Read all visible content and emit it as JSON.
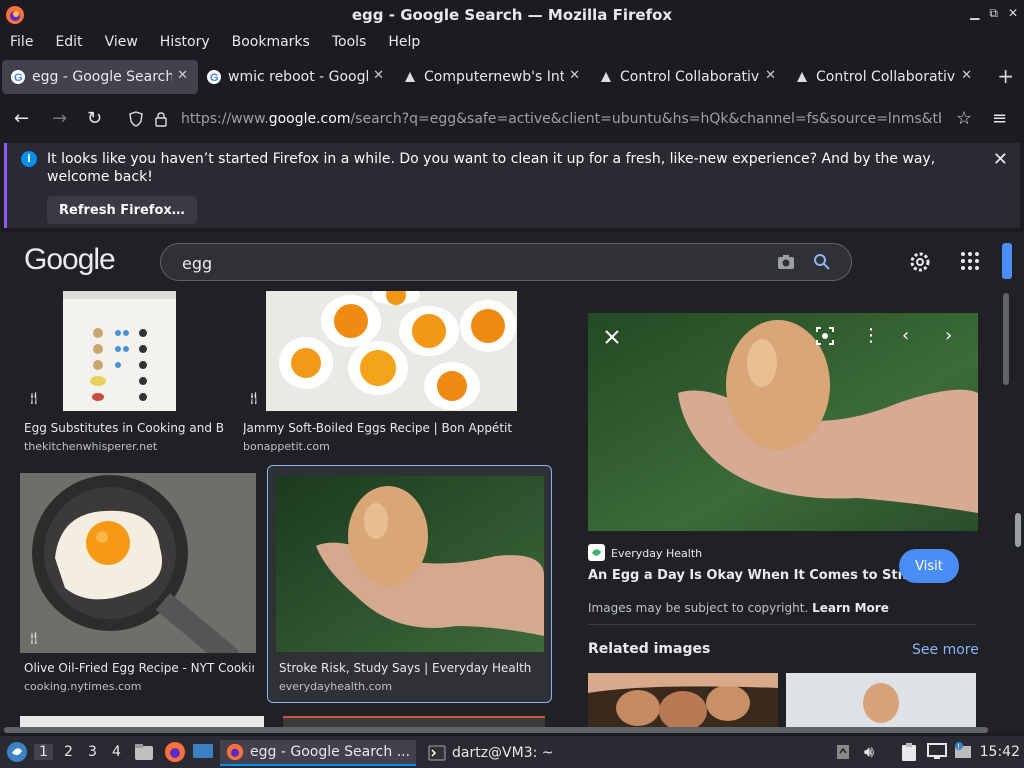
{
  "window": {
    "title": "egg - Google Search — Mozilla Firefox"
  },
  "menu": [
    "File",
    "Edit",
    "View",
    "History",
    "Bookmarks",
    "Tools",
    "Help"
  ],
  "tabs": [
    {
      "label": "egg - Google Search",
      "icon": "google-icon",
      "active": true
    },
    {
      "label": "wmic reboot - Google",
      "icon": "google-icon",
      "active": false
    },
    {
      "label": "Computernewb's Inte",
      "icon": "site-icon",
      "active": false
    },
    {
      "label": "Control Collaborative",
      "icon": "site-icon",
      "active": false
    },
    {
      "label": "Control Collaborative",
      "icon": "site-icon",
      "active": false
    }
  ],
  "url": {
    "scheme": "https://www.",
    "host": "google.com",
    "rest": "/search?q=egg&safe=active&client=ubuntu&hs=hQk&channel=fs&source=lnms&tb"
  },
  "notification": {
    "message": "It looks like you haven’t started Firefox in a while. Do you want to clean it up for a fresh, like-new experience? And by the way, welcome back!",
    "button": "Refresh Firefox…"
  },
  "google": {
    "logo": "Google",
    "query": "egg"
  },
  "results": [
    {
      "caption": "Egg Substitutes in Cooking and B...",
      "source": "thekitchenwhisperer.net"
    },
    {
      "caption": "Jammy Soft-Boiled Eggs Recipe | Bon Appétit",
      "source": "bonappetit.com"
    },
    {
      "caption": "Olive Oil-Fried Egg Recipe - NYT Cooking",
      "source": "cooking.nytimes.com"
    },
    {
      "caption": "Stroke Risk, Study Says | Everyday Health",
      "source": "everydayhealth.com"
    }
  ],
  "preview": {
    "site": "Everyday Health",
    "title": "An Egg a Day Is Okay When It Comes to Str...",
    "visit": "Visit",
    "copyright": "Images may be subject to copyright.",
    "learn_more": "Learn More",
    "related": "Related images",
    "see_more": "See more"
  },
  "taskbar": {
    "workspaces": [
      "1",
      "2",
      "3",
      "4"
    ],
    "firefox_task": "egg - Google Search ...",
    "terminal_task": "dartz@VM3: ~",
    "clock": "15:42"
  },
  "colors": {
    "accent": "#8ab4f8",
    "visit_button": "#4b8df8",
    "notification_border": "#8a5cf5"
  }
}
